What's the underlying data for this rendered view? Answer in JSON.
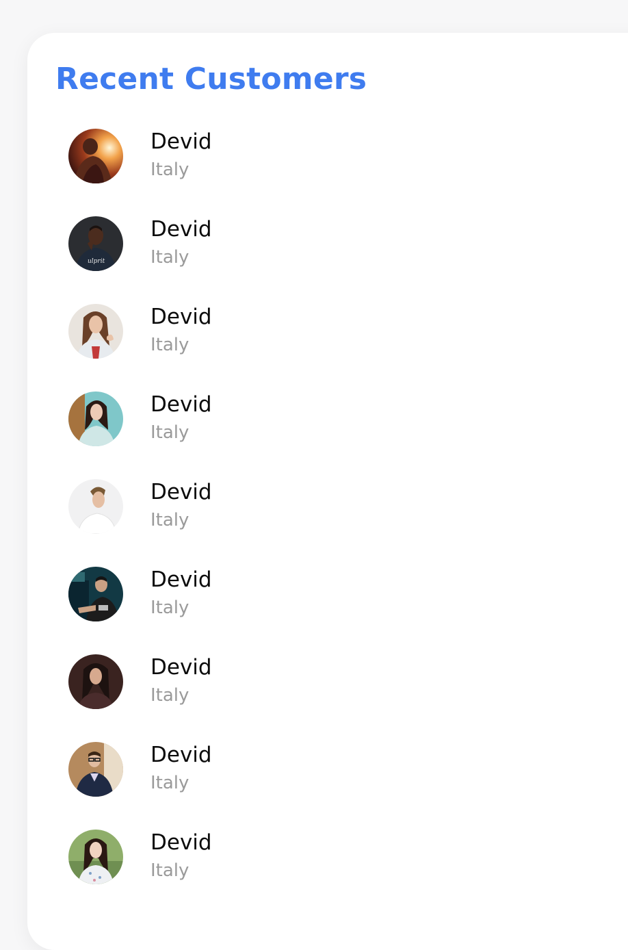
{
  "panel": {
    "title": "Recent Customers"
  },
  "theme": {
    "accent": "#3f7cef",
    "name_color": "#0c0c0c",
    "country_color": "#9a9a9a"
  },
  "customers": [
    {
      "name": "Devid",
      "country": "Italy",
      "avatar": "sunset-man-photo"
    },
    {
      "name": "Devid",
      "country": "Italy",
      "avatar": "man-navy-shirt-photo"
    },
    {
      "name": "Devid",
      "country": "Italy",
      "avatar": "woman-long-hair-photo"
    },
    {
      "name": "Devid",
      "country": "Italy",
      "avatar": "woman-teal-background-photo"
    },
    {
      "name": "Devid",
      "country": "Italy",
      "avatar": "man-white-tee-photo"
    },
    {
      "name": "Devid",
      "country": "Italy",
      "avatar": "man-at-desk-photo"
    },
    {
      "name": "Devid",
      "country": "Italy",
      "avatar": "woman-dark-portrait-photo"
    },
    {
      "name": "Devid",
      "country": "Italy",
      "avatar": "man-glasses-suit-photo"
    },
    {
      "name": "Devid",
      "country": "Italy",
      "avatar": "woman-smiling-photo"
    }
  ]
}
